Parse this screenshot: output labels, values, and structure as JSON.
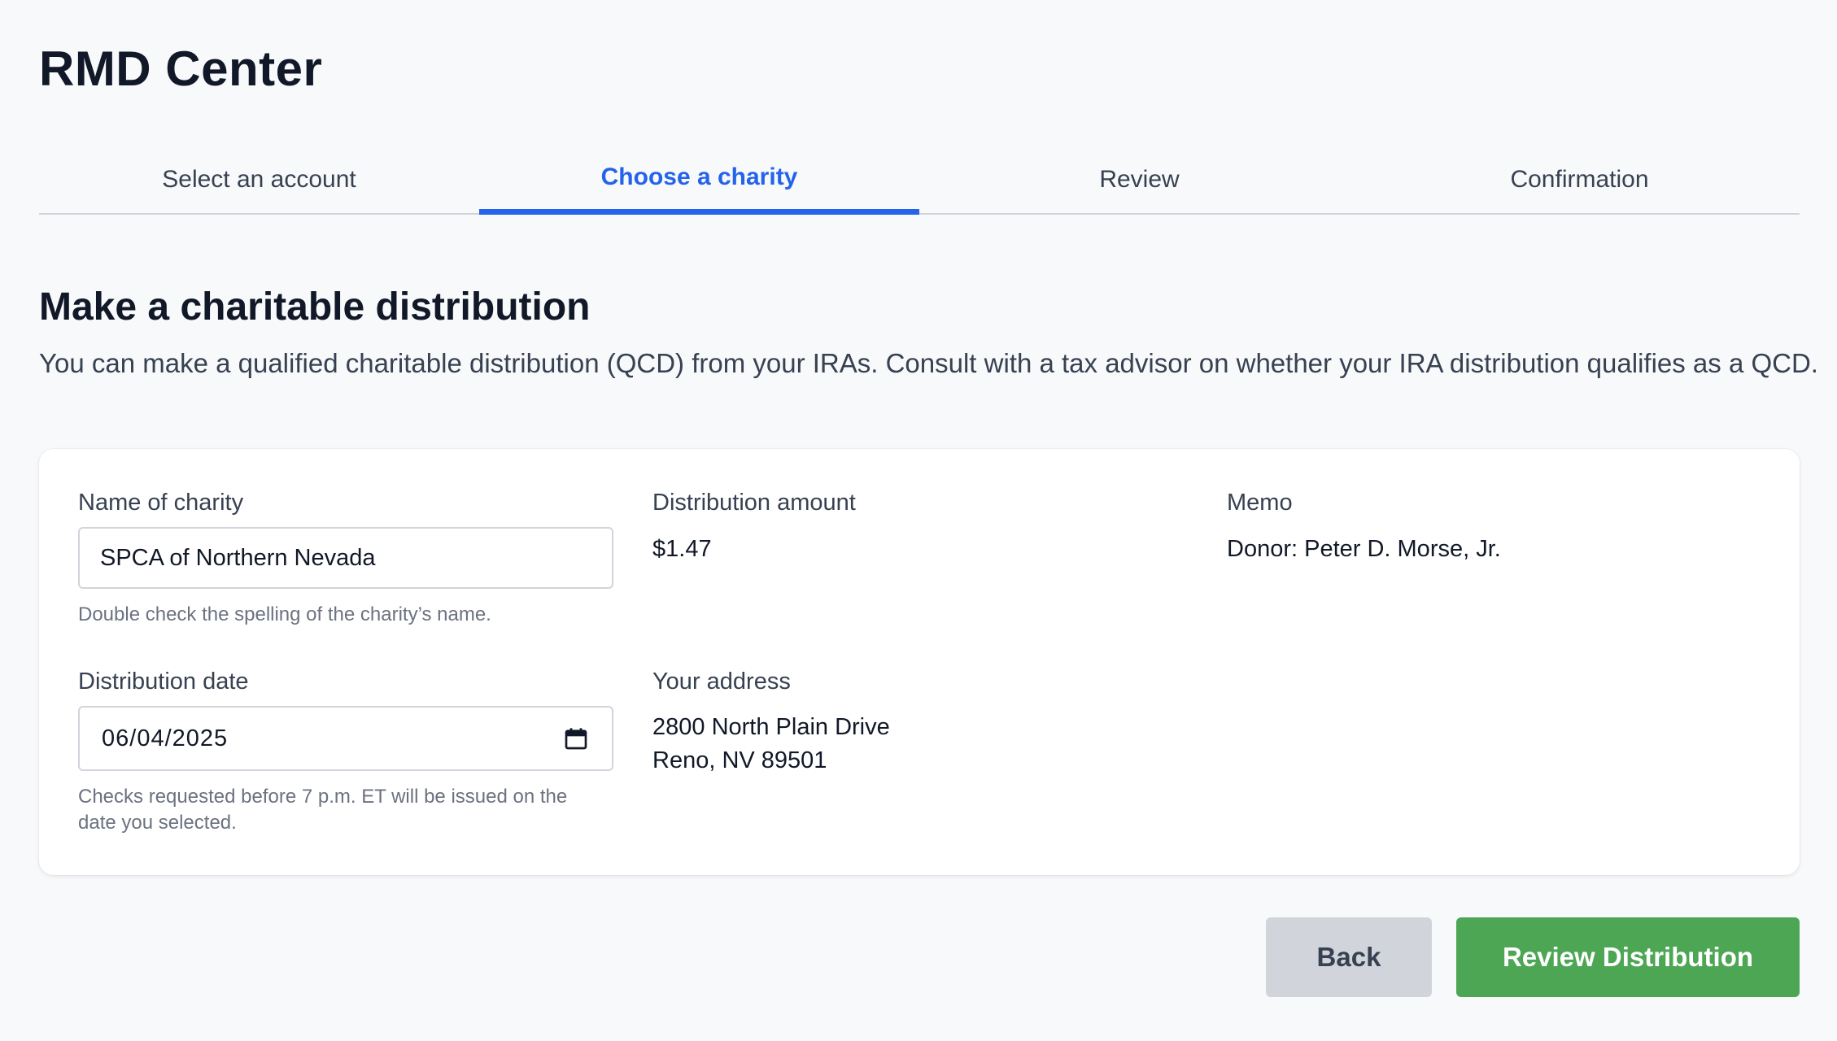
{
  "app": {
    "title": "RMD Center"
  },
  "steps": [
    {
      "label": "Select an account",
      "active": false
    },
    {
      "label": "Choose a charity",
      "active": true
    },
    {
      "label": "Review",
      "active": false
    },
    {
      "label": "Confirmation",
      "active": false
    }
  ],
  "section": {
    "title": "Make a charitable distribution",
    "intro": "You can make a qualified charitable distribution (QCD) from your IRAs. Consult with a tax advisor on whether your IRA distribution qualifies as a QCD."
  },
  "form": {
    "charity": {
      "label": "Name of charity",
      "value": "SPCA of Northern Nevada",
      "hint": "Double check the spelling of the charity’s name."
    },
    "amount": {
      "label": "Distribution amount",
      "value": "$1.47"
    },
    "memo": {
      "label": "Memo",
      "value": "Donor: Peter D. Morse, Jr."
    },
    "date": {
      "label": "Distribution date",
      "value": "06/04/2025",
      "icon": "calendar-icon",
      "hint_line1": "Checks requested before 7 p.m. ET will be issued on the",
      "hint_line2": "date you selected."
    },
    "address": {
      "label": "Your address",
      "line1": "2800 North Plain Drive",
      "line2": "Reno, NV 89501"
    }
  },
  "actions": {
    "back_label": "Back",
    "review_label": "Review Distribution"
  },
  "colors": {
    "accent": "#2563eb",
    "primary_button": "#4da654",
    "secondary_button": "#d1d5db",
    "background": "#f8f9fb"
  }
}
